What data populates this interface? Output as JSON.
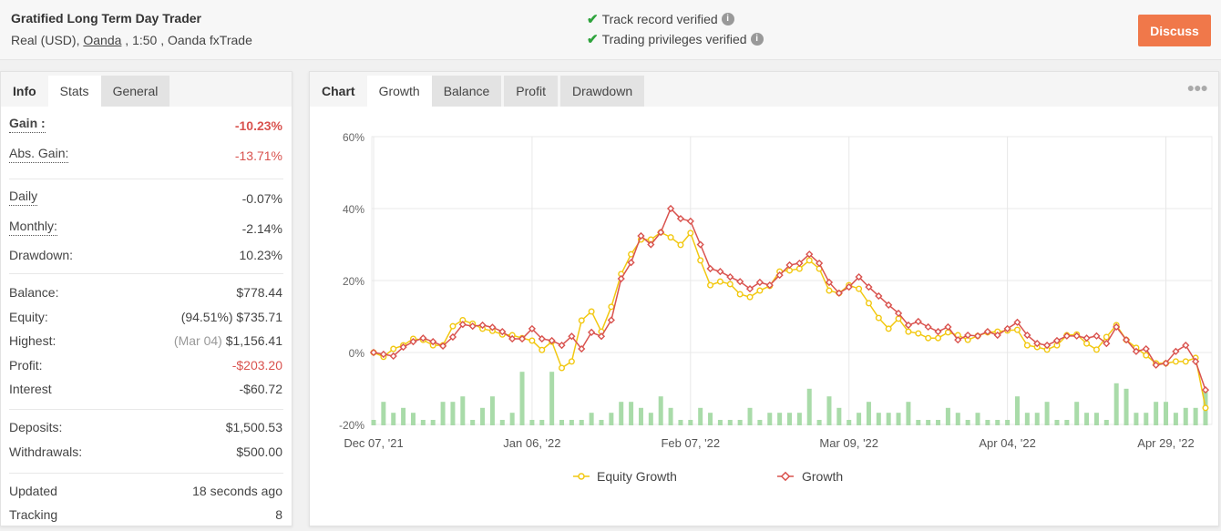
{
  "header": {
    "title": "Gratified Long Term Day Trader",
    "account_type": "Real (USD),",
    "broker": "Oanda",
    "rest": ", 1:50 , Oanda fxTrade",
    "verifications": [
      "Track record verified",
      "Trading privileges verified"
    ],
    "discuss_label": "Discuss"
  },
  "left": {
    "tab_label": "Info",
    "tabs": [
      "Stats",
      "General"
    ],
    "active_tab": "Stats",
    "stats": {
      "gain_label": "Gain :",
      "gain": "-10.23%",
      "abs_gain_label": "Abs. Gain:",
      "abs_gain": "-13.71%",
      "daily_label": "Daily",
      "daily": "-0.07%",
      "monthly_label": "Monthly:",
      "monthly": "-2.14%",
      "drawdown_label": "Drawdown:",
      "drawdown": "10.23%",
      "balance_label": "Balance:",
      "balance": "$778.44",
      "equity_label": "Equity:",
      "equity_pct": "(94.51%)",
      "equity": "$735.71",
      "highest_label": "Highest:",
      "highest_date": "(Mar 04)",
      "highest": "$1,156.41",
      "profit_label": "Profit:",
      "profit": "-$203.20",
      "interest_label": "Interest",
      "interest": "-$60.72",
      "deposits_label": "Deposits:",
      "deposits": "$1,500.53",
      "withdrawals_label": "Withdrawals:",
      "withdrawals": "$500.00",
      "updated_label": "Updated",
      "updated": "18 seconds ago",
      "tracking_label": "Tracking",
      "tracking": "8"
    }
  },
  "right": {
    "tab_label": "Chart",
    "tabs": [
      "Growth",
      "Balance",
      "Profit",
      "Drawdown"
    ],
    "active_tab": "Growth",
    "menu_icon": "more-dots-icon"
  },
  "chart_data": {
    "type": "line",
    "y_ticks": [
      "60%",
      "40%",
      "20%",
      "0%",
      "-20%"
    ],
    "ylim": [
      -20,
      60
    ],
    "grid": true,
    "legend": "bottom",
    "x_tick_labels": [
      "Dec 07, '21",
      "Jan 06, '22",
      "Feb 07, '22",
      "Mar 09, '22",
      "Apr 04, '22",
      "Apr 29, '22"
    ],
    "series": [
      {
        "name": "Equity Growth",
        "color": "#f2c811",
        "values": [
          0,
          -1.2,
          1,
          2,
          3.8,
          3.5,
          2,
          2,
          7.3,
          9,
          8,
          6.6,
          6,
          5,
          4.8,
          4,
          3.3,
          0.7,
          3,
          -4.3,
          -2.5,
          8.9,
          11.4,
          5.8,
          12.7,
          21.8,
          27.3,
          31.4,
          31.4,
          33.4,
          32,
          29.9,
          33.2,
          25.6,
          18.7,
          19.7,
          19,
          16.2,
          15.4,
          17.2,
          18.5,
          22.5,
          22.8,
          23.3,
          25.6,
          23.3,
          17.2,
          16.5,
          18.7,
          17.7,
          13.7,
          9.6,
          6.6,
          9.4,
          5.8,
          5.3,
          4,
          4,
          5.6,
          4.8,
          3.5,
          4.6,
          5.6,
          5.8,
          6.1,
          6.3,
          2,
          1.5,
          0.8,
          2,
          4.8,
          5,
          2.5,
          0.8,
          4.3,
          7.6,
          3.5,
          1.3,
          -0.8,
          -3,
          -3,
          -2.5,
          -2.5,
          -1.5,
          -15.4
        ]
      },
      {
        "name": "Growth",
        "color": "#d9534f",
        "values": [
          0,
          -0.5,
          -1,
          1.5,
          3,
          4,
          3,
          1.8,
          4.3,
          7.8,
          7.3,
          7.6,
          7,
          5.8,
          3.8,
          3.8,
          6.6,
          3.8,
          3.3,
          2,
          4.5,
          1,
          5.6,
          4.5,
          9,
          20.5,
          25,
          32.4,
          30,
          33.4,
          40,
          37.2,
          36.5,
          30,
          23.3,
          22.5,
          21,
          19.7,
          17.7,
          19.5,
          18.7,
          21.5,
          24.3,
          24.8,
          27.3,
          24.8,
          19.5,
          16.5,
          18.2,
          21,
          18.2,
          15.7,
          13.2,
          10.9,
          7.6,
          8.6,
          7.1,
          5.8,
          7.1,
          3.5,
          4.8,
          4.6,
          5.8,
          4.8,
          6.6,
          8.4,
          4.8,
          2.5,
          2,
          3.3,
          4.6,
          4.6,
          4,
          4.6,
          2.5,
          7.1,
          3.5,
          0.3,
          1,
          -3.5,
          -3,
          0.3,
          2,
          -2.5,
          -10.4
        ]
      }
    ],
    "bars": {
      "color": "#a9dba9",
      "values": [
        1,
        4.3,
        2.3,
        3.2,
        2.3,
        1,
        1,
        4.3,
        4.3,
        5.3,
        1,
        3.2,
        5.3,
        1,
        2.3,
        9.8,
        1,
        1,
        9.8,
        1,
        1,
        1,
        2.3,
        1,
        2.3,
        4.3,
        4.3,
        3.2,
        2.3,
        5.3,
        3.2,
        1,
        1,
        3.2,
        2.3,
        1,
        1,
        1,
        3.2,
        1,
        2.3,
        2.3,
        2.3,
        2.3,
        6.7,
        1,
        5.3,
        3.2,
        1,
        2.3,
        4.3,
        2.3,
        2.3,
        2.3,
        4.3,
        1,
        1,
        1,
        3.2,
        2.3,
        1,
        2.3,
        1,
        1,
        1,
        5.3,
        2.3,
        2.3,
        4.3,
        1,
        1,
        4.3,
        2.3,
        2.3,
        1,
        7.7,
        6.7,
        2.3,
        2.3,
        4.3,
        4.3,
        2.3,
        3.2,
        3.2,
        6.5
      ]
    }
  }
}
